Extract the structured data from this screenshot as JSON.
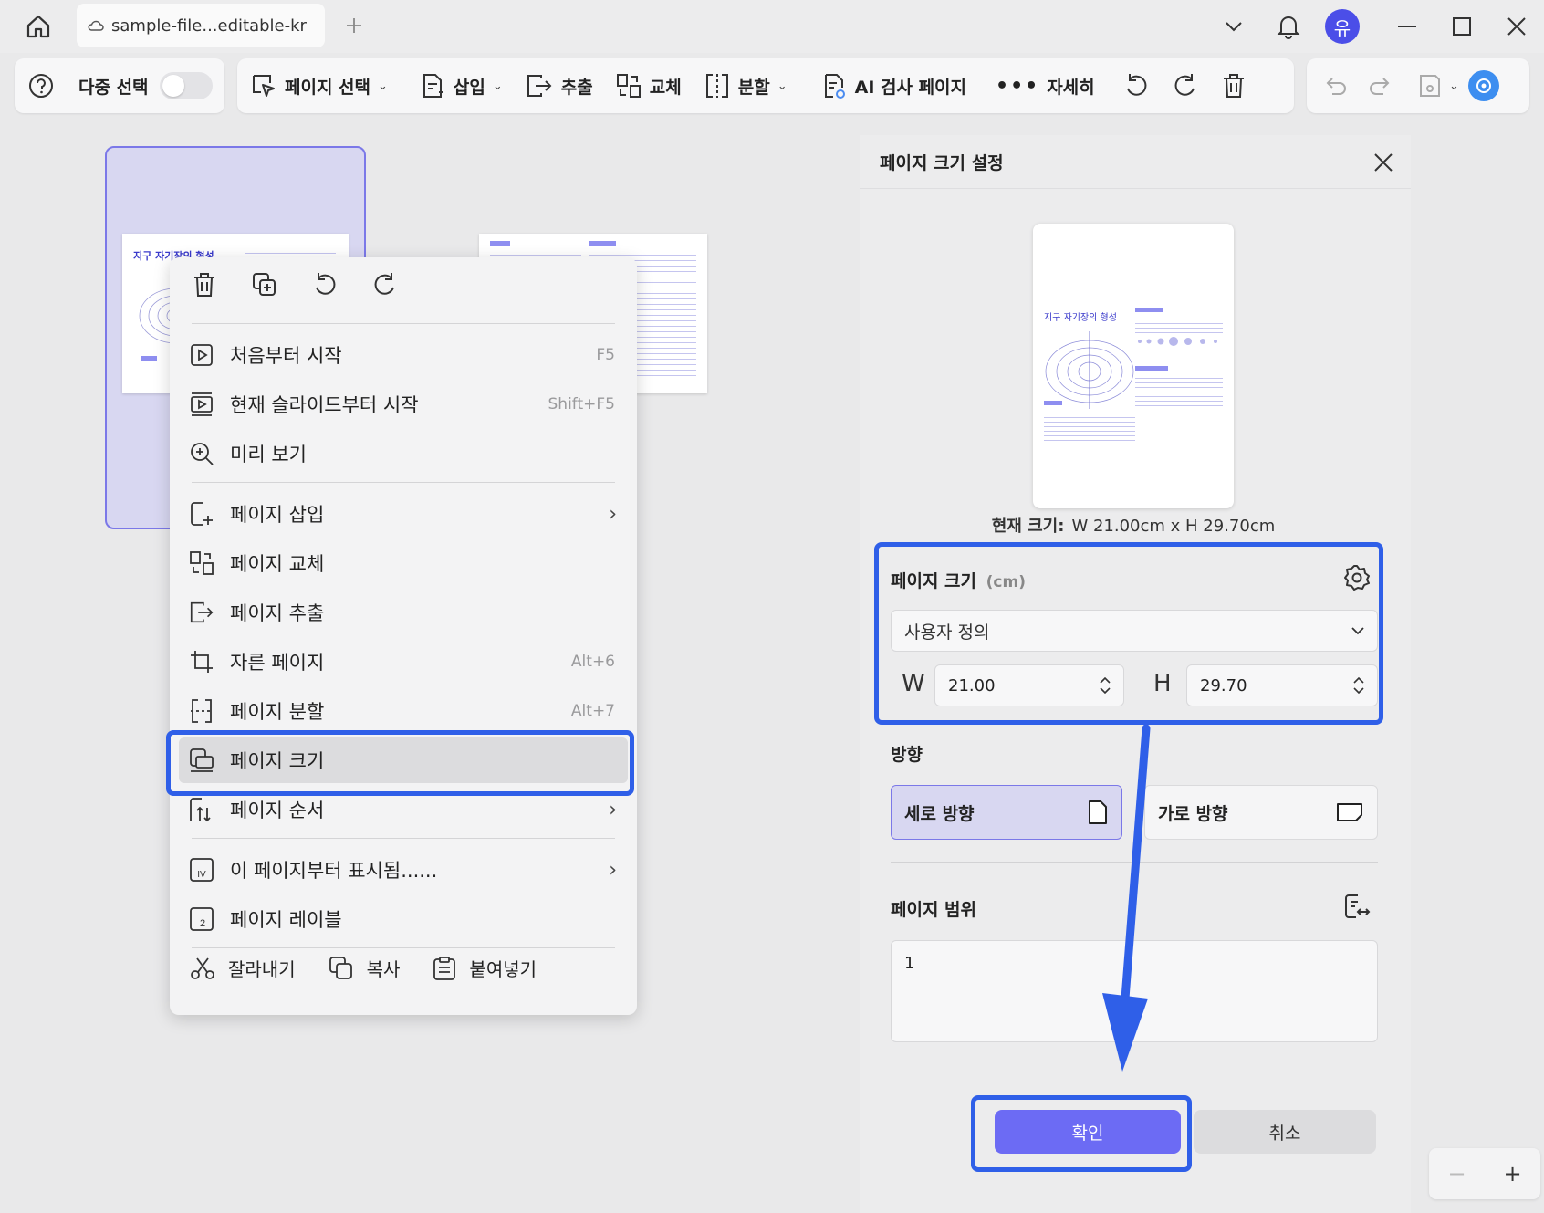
{
  "titlebar": {
    "doc_name": "sample-file...editable-kr",
    "avatar_initial": "유"
  },
  "toolbar": {
    "multi_select": "다중 선택",
    "page_select": "페이지 선택",
    "insert": "삽입",
    "extract": "추출",
    "replace": "교체",
    "split": "분할",
    "ai_check": "AI 검사 페이지",
    "more": "자세히"
  },
  "thumbnails": {
    "page1_title": "지구 자기장의 형성"
  },
  "context_menu": {
    "items": [
      {
        "label": "처음부터 시작",
        "shortcut": "F5"
      },
      {
        "label": "현재 슬라이드부터 시작",
        "shortcut": "Shift+F5"
      },
      {
        "label": "미리 보기",
        "shortcut": ""
      },
      {
        "label": "페이지 삽입",
        "shortcut": ""
      },
      {
        "label": "페이지 교체",
        "shortcut": ""
      },
      {
        "label": "페이지 추출",
        "shortcut": ""
      },
      {
        "label": "자른 페이지",
        "shortcut": "Alt+6"
      },
      {
        "label": "페이지 분할",
        "shortcut": "Alt+7"
      },
      {
        "label": "페이지 크기",
        "shortcut": ""
      },
      {
        "label": "페이지 순서",
        "shortcut": ""
      },
      {
        "label": "이 페이지부터 표시됨......",
        "shortcut": ""
      },
      {
        "label": "페이지 레이블",
        "shortcut": ""
      }
    ],
    "cut": "잘라내기",
    "copy": "복사",
    "paste": "붙여넣기"
  },
  "panel": {
    "title": "페이지 크기 설정",
    "preview_title": "지구 자기장의 형성",
    "current_size_label": "현재 크기:",
    "current_size_value": "W 21.00cm x H 29.70cm",
    "page_size_label": "페이지 크기",
    "page_size_unit": "(cm)",
    "preset": "사용자 정의",
    "w_label": "W",
    "w_value": "21.00",
    "h_label": "H",
    "h_value": "29.70",
    "orientation_label": "방향",
    "portrait": "세로 방향",
    "landscape": "가로 방향",
    "range_label": "페이지 범위",
    "range_value": "1",
    "ok": "확인",
    "cancel": "취소"
  },
  "colors": {
    "accent": "#6c6bf4",
    "highlight": "#2f5fe8",
    "selection": "#d8d7f1"
  }
}
